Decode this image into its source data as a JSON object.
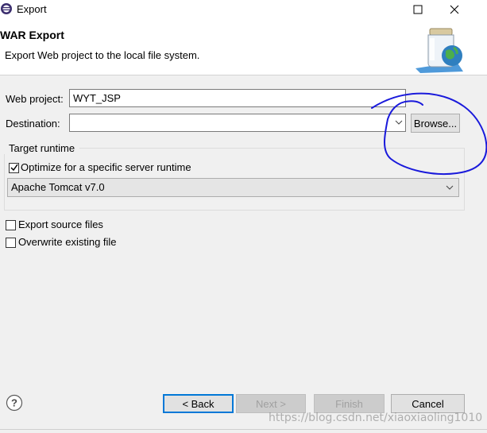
{
  "window": {
    "title": "Export",
    "icons": {
      "app": "eclipse-icon",
      "maximize": "maximize-icon",
      "close": "close-icon"
    }
  },
  "banner": {
    "title": "WAR Export",
    "description": "Export Web project to the local file system.",
    "graphic": "war-export-jar-icon"
  },
  "form": {
    "web_project_label": "Web project:",
    "web_project_value": "WYT_JSP",
    "destination_label": "Destination:",
    "destination_value": "",
    "browse_label": "Browse...",
    "target_runtime": {
      "group_label": "Target runtime",
      "optimize_label": "Optimize for a specific server runtime",
      "optimize_checked": true,
      "server_runtime_value": "Apache Tomcat v7.0"
    },
    "export_source_label": "Export source files",
    "export_source_checked": false,
    "overwrite_label": "Overwrite existing file",
    "overwrite_checked": false
  },
  "footer": {
    "help_icon": "help-icon",
    "back_label": "< Back",
    "next_label": "Next >",
    "finish_label": "Finish",
    "cancel_label": "Cancel"
  },
  "annotation": {
    "color": "#1a1adb"
  },
  "watermark": "https://blog.csdn.net/xiaoxiaoling1010"
}
